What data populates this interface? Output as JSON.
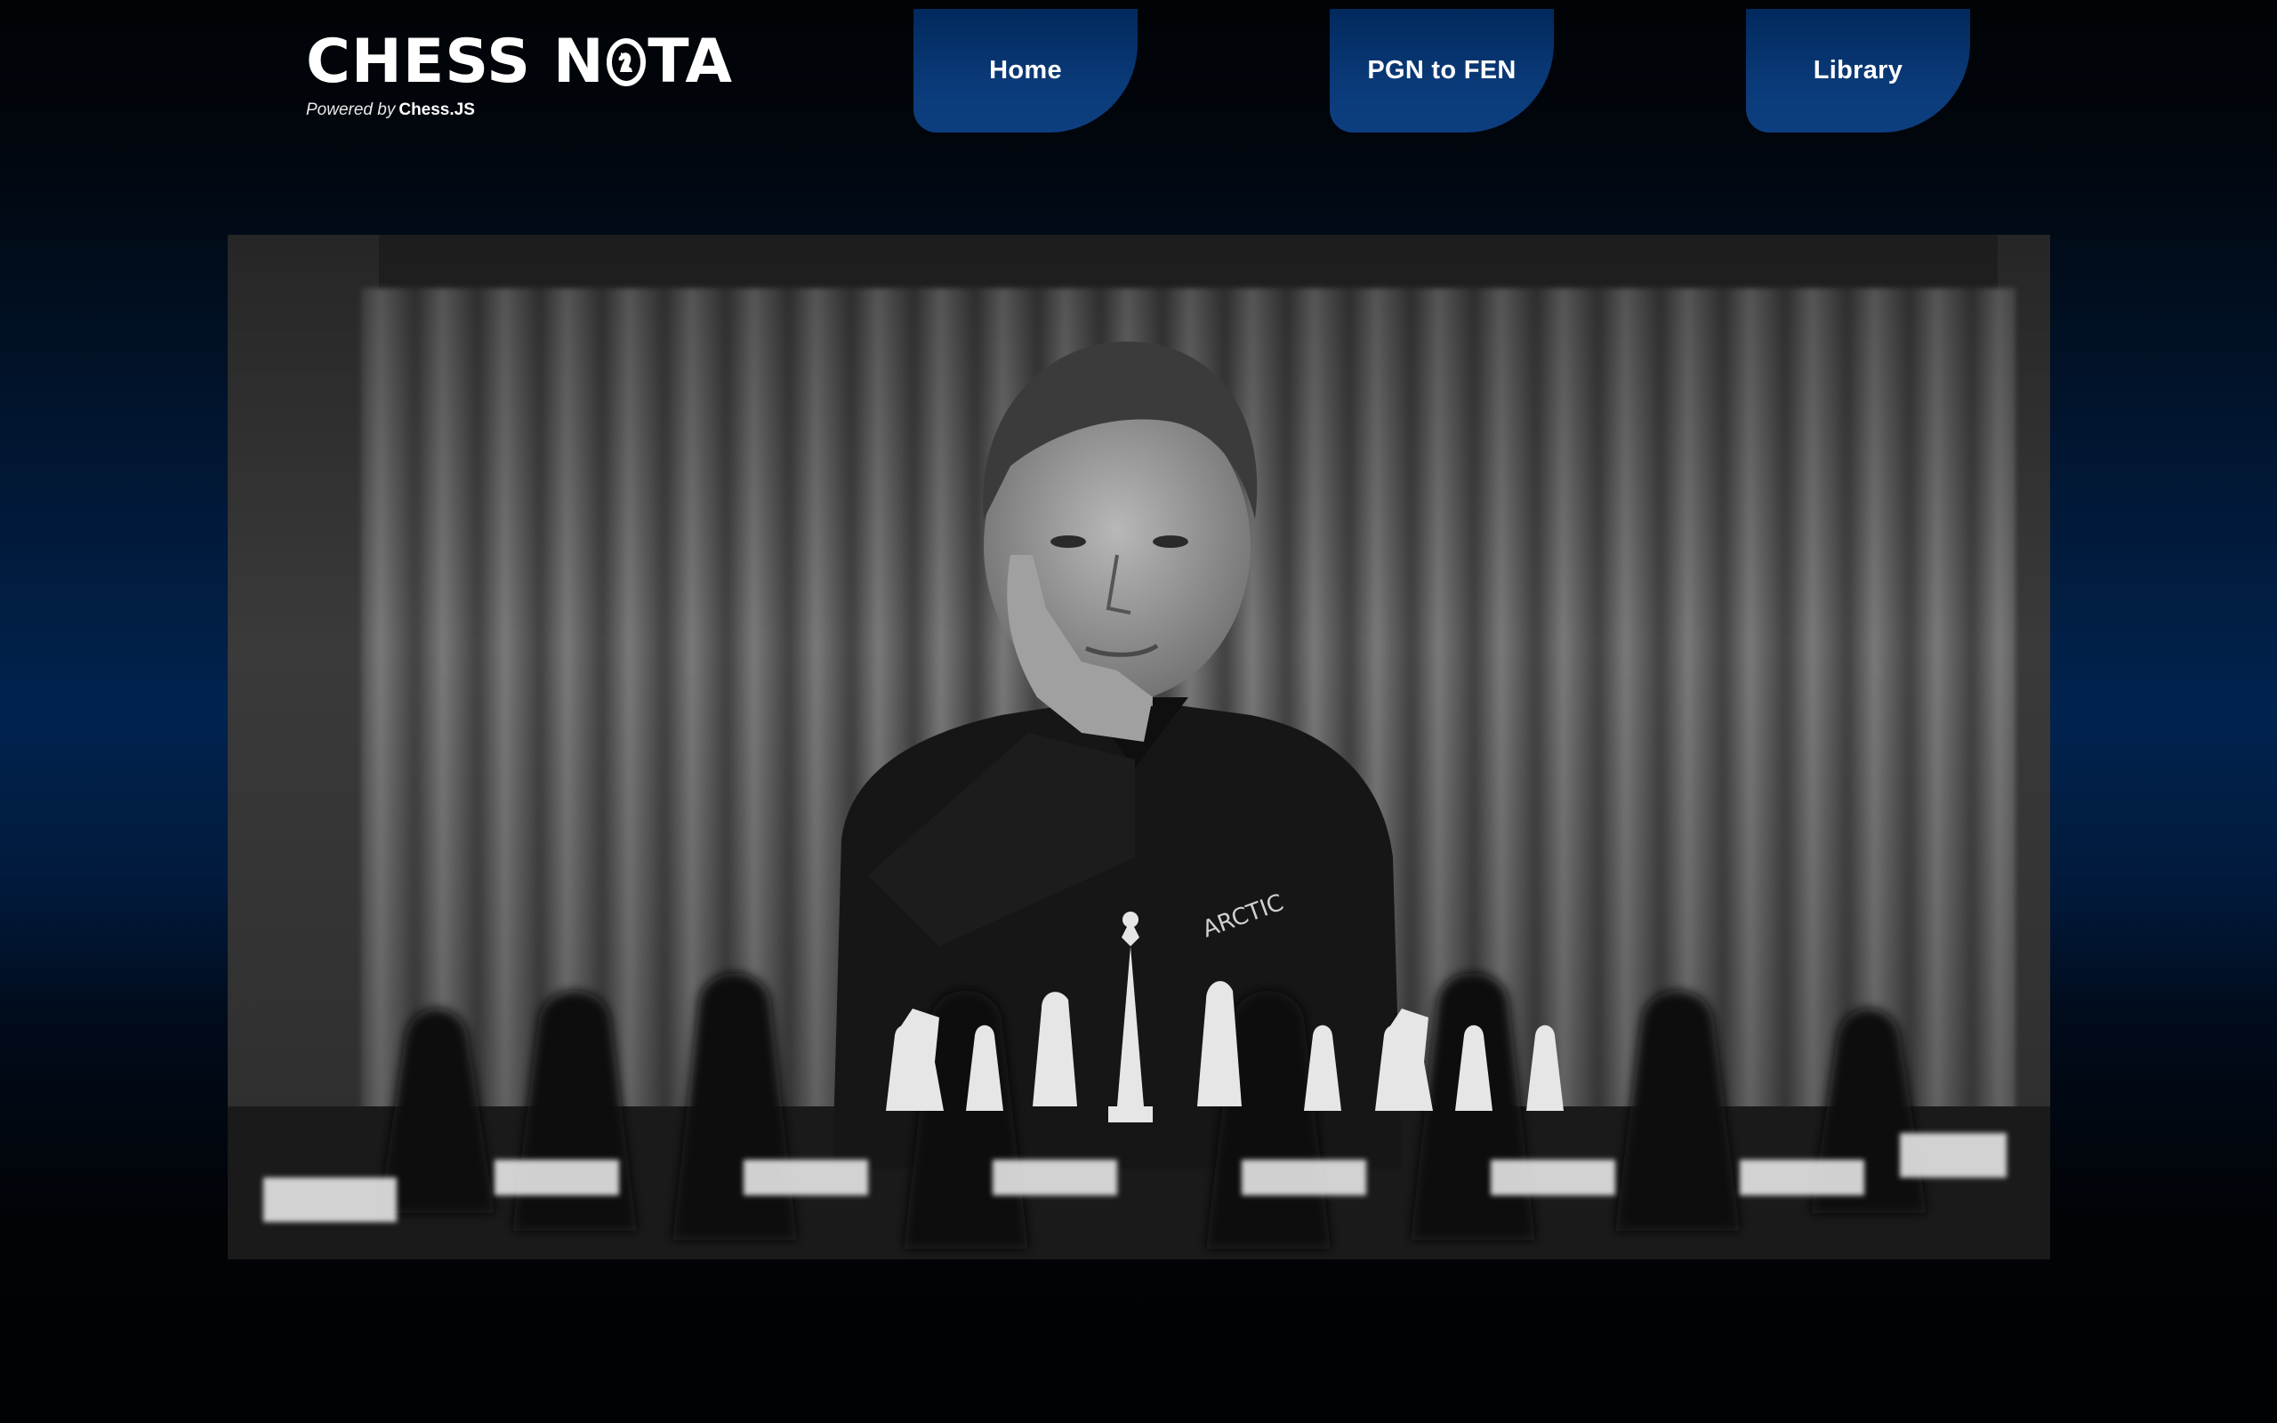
{
  "logo": {
    "title_left": "CHESS N",
    "title_right": "TA",
    "powered_by_prefix": "Powered by",
    "powered_by_brand": "Chess.JS"
  },
  "nav": {
    "items": [
      {
        "label": "Home"
      },
      {
        "label": "PGN to FEN"
      },
      {
        "label": "Library"
      }
    ]
  },
  "hero": {
    "image_kind": "black-and-white photo of chess player behind a chessboard",
    "jacket_text": "ARCTIC"
  },
  "colors": {
    "background_dark": "#010306",
    "background_blue": "#01234f",
    "tab_blue": "#01295d",
    "text": "#ffffff"
  }
}
